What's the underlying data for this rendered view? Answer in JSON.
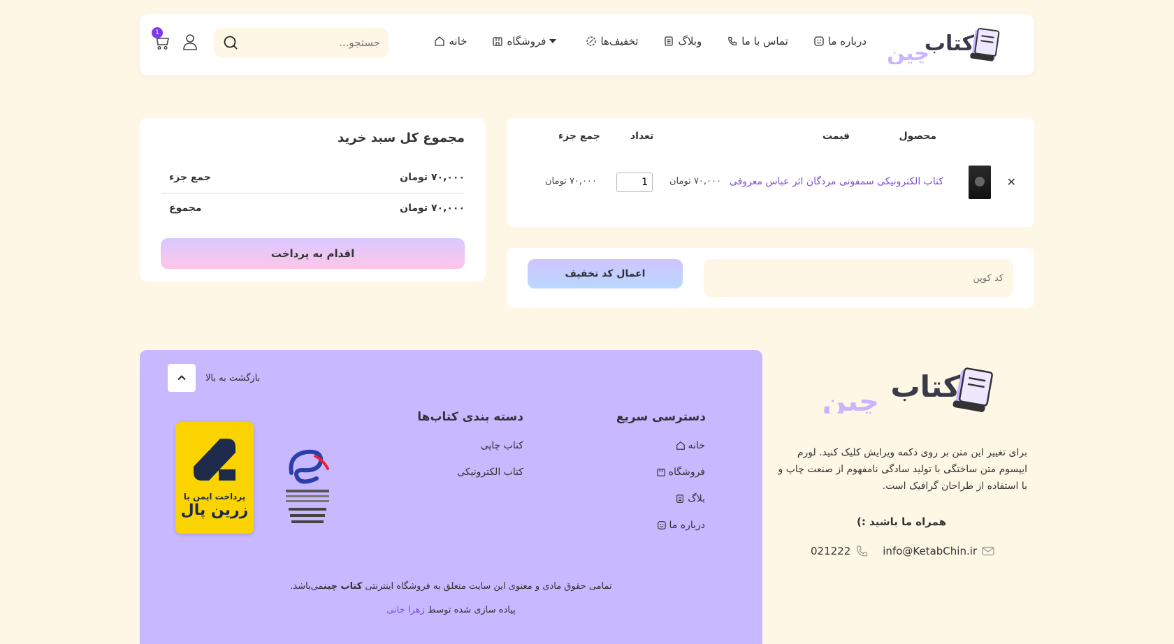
{
  "brand": {
    "name": "کتاب چین",
    "colors": {
      "accent": "#7c3aed",
      "background": "#fff7e6",
      "footer": "#c8b8ff",
      "link": "#7c4fd8"
    }
  },
  "header": {
    "nav": [
      {
        "label": "خانه",
        "icon": "home-icon"
      },
      {
        "label": "فروشگاه",
        "icon": "shop-icon",
        "has_dropdown": true
      },
      {
        "label": "تخفیف‌ها",
        "icon": "discount-icon"
      },
      {
        "label": "وبلاگ",
        "icon": "blog-icon"
      },
      {
        "label": "تماس با ما",
        "icon": "phone-icon"
      },
      {
        "label": "درباره ما",
        "icon": "smile-icon"
      }
    ],
    "search_placeholder": "جستجو...",
    "cart_count": "1"
  },
  "cart": {
    "headers": {
      "product": "محصول",
      "price": "قیمت",
      "qty": "تعداد",
      "subtotal": "جمع جزء"
    },
    "items": [
      {
        "name": "کتاب الکترونیکی سمفونی مردگان اثر عباس معروفی",
        "price": "۷۰,۰۰۰ تومان",
        "qty": "1",
        "subtotal": "۷۰,۰۰۰ تومان"
      }
    ]
  },
  "coupon": {
    "placeholder": "کد کوپن",
    "button": "اعمال کد تخفیف"
  },
  "totals": {
    "title": "مجموع کل سبد خرید",
    "subtotal_label": "جمع جزء",
    "subtotal_value": "۷۰,۰۰۰ تومان",
    "total_label": "مجموع",
    "total_value": "۷۰,۰۰۰ تومان",
    "checkout_button": "اقدام به پرداخت"
  },
  "footer": {
    "back_to_top": "بازگشت به بالا",
    "quick_access_title": "دسترسی سریع",
    "quick_access": [
      {
        "label": "خانه",
        "icon": "home-icon"
      },
      {
        "label": "فروشگاه",
        "icon": "shop-icon"
      },
      {
        "label": "بلاگ",
        "icon": "blog-icon"
      },
      {
        "label": "درباره ما",
        "icon": "smile-icon"
      }
    ],
    "categories_title": "دسته بندی کتاب‌ها",
    "categories": [
      "کتاب چاپی",
      "کتاب الکترونیکی"
    ],
    "zarinpal_title": "پرداخت ایمن با",
    "zarinpal_name": "زرین پال",
    "copyright_pre": "تمامی حقوق مادی و معنوی این سایت متعلق به فروشگاه اینترنتی",
    "copyright_brand": "کتاب چین",
    "copyright_post": "می‌باشد.",
    "built_pre": "پیاده سازی شده توسط",
    "built_name": "زهرا خانی",
    "description": "برای تغییر این متن بر روی دکمه ویرایش کلیک کنید. لورم ایپسوم متن ساختگی با تولید سادگی نامفهوم از صنعت چاپ و با استفاده از طراحان گرافیک است.",
    "follow": "همراه ما باشید :)",
    "email": "info@KetabChin.ir",
    "phone": "021222"
  }
}
